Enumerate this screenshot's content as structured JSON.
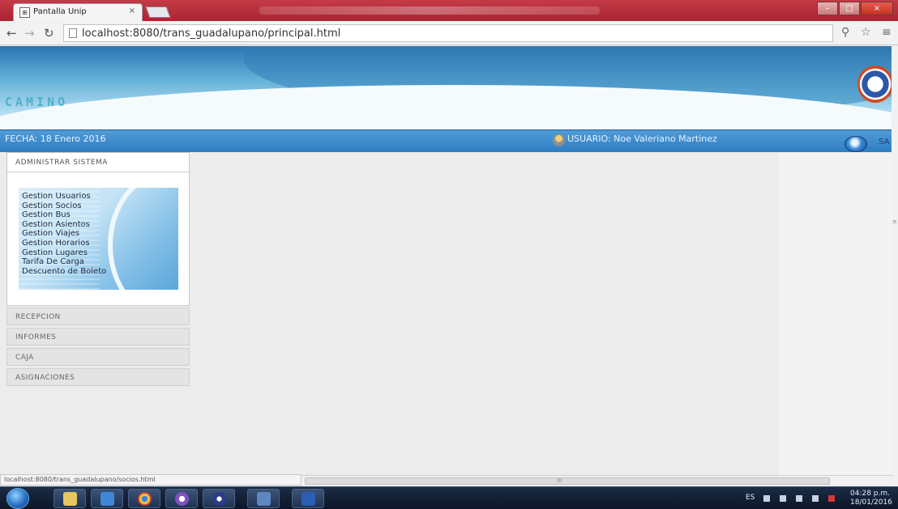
{
  "browser": {
    "tab_title": "Pantalla Unip",
    "tab_close": "×",
    "address": "localhost:8080/trans_guadalupano/principal.html",
    "win_minimize": "–",
    "win_maximize": "□",
    "win_close": "×"
  },
  "header": {
    "brand": "CAMINO",
    "fecha": "FECHA:   18 Enero 2016",
    "usuario": "USUARIO:  Noe Valeriano Martinez",
    "salir": "SA"
  },
  "sidebar": {
    "admin_title": "ADMINISTRAR SISTEMA",
    "admin_items": [
      "Gestion Usuarios",
      "Gestion Socios",
      "Gestion Bus",
      "Gestion Asientos",
      "Gestion Viajes",
      "Gestion Horarios",
      "Gestion Lugares",
      "Tarifa De Carga",
      "Descuento de Boleto"
    ],
    "sections": [
      "RECEPCION",
      "INFORMES",
      "CAJA",
      "ASIGNACIONES"
    ]
  },
  "status": {
    "url": "localhost:8080/trans_guadalupano/socios.html",
    "scroll_grip": "III"
  },
  "taskbar": {
    "lang": "ES",
    "time": "04:28 p.m.",
    "date": "18/01/2016"
  },
  "colors": {
    "banner_top": "#2a74b4",
    "infobar": "#3a87c9",
    "titlebar": "#b82e3a"
  }
}
